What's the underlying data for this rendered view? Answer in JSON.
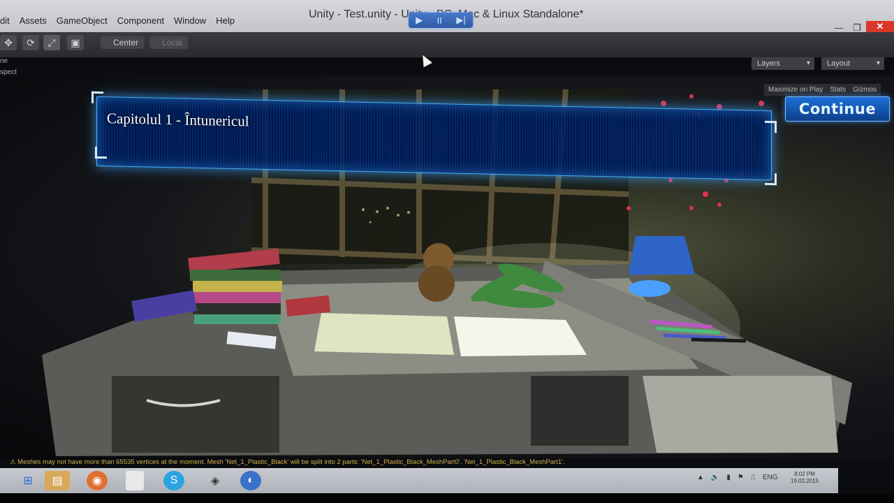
{
  "window": {
    "title": "Unity - Test.unity - Unity - PC, Mac & Linux Standalone*",
    "min_symbol": "—",
    "max_symbol": "❐",
    "close_symbol": "✕"
  },
  "menu": [
    "dit",
    "Assets",
    "GameObject",
    "Component",
    "Window",
    "Help"
  ],
  "toolbar": {
    "tools": [
      "move-icon",
      "rotate-icon",
      "scale-icon",
      "rect-icon"
    ],
    "pivot_center": "Center",
    "pivot_local": "Local",
    "play_icons": [
      "▶",
      "II",
      "▶|"
    ],
    "layers": "Layers",
    "layout": "Layout"
  },
  "side_labels": [
    "ne",
    "spect"
  ],
  "game_view": {
    "maximize_on_play": "Maximize on Play",
    "stats": "Stats",
    "gizmos": "Gizmos",
    "chapter_title": "Capitolul 1 - Întunericul",
    "continue_label": "Continue"
  },
  "console": {
    "message": "⚠ Meshes may not have more than 65535 vertices at the moment. Mesh 'Net_1_Plastic_Black' will be split into 2 parts: 'Net_1_Plastic_Black_MeshPart0', 'Net_1_Plastic_Black_MeshPart1'.",
    "color": "#d6b34c"
  },
  "taskbar": {
    "apps": [
      "windows-start-icon",
      "file-explorer-icon",
      "firefox-icon",
      "blank-app-icon",
      "skype-icon",
      "unity-icon",
      "app-icon"
    ],
    "language": "ENG",
    "time": "8:02 PM",
    "date": "19.02.2015"
  },
  "colors": {
    "banner_border": "#46b3ff",
    "continue_bg": "#1c6fd8",
    "play_active": "#4a79c7"
  }
}
